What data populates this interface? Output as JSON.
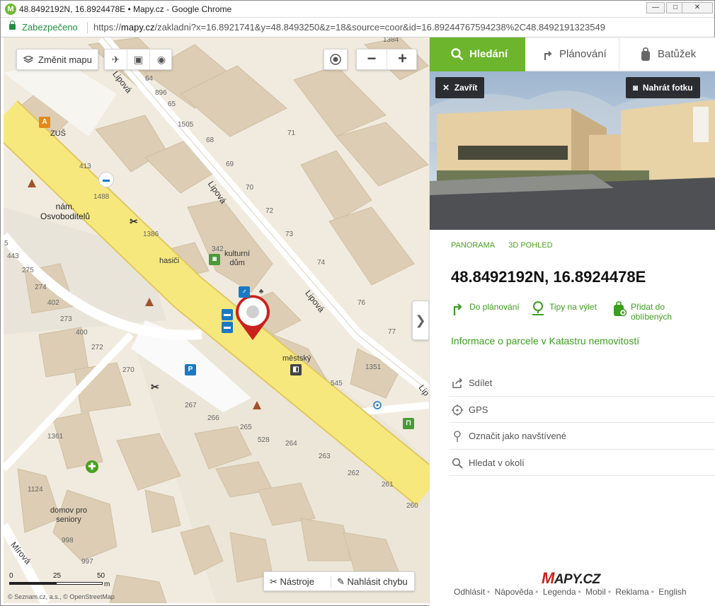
{
  "window": {
    "title": "48.8492192N, 16.8924478E • Mapy.cz - Google Chrome",
    "app_icon": "M",
    "btn_min": "—",
    "btn_max": "□",
    "btn_close": "✕"
  },
  "address_bar": {
    "secure_label": "Zabezpečeno",
    "url_prefix": "https://",
    "url_domain": "mapy.cz",
    "url_rest": "/zakladni?x=16.8921741&y=48.8493250&z=18&source=coor&id=16.89244767594238%2C48.8492191323549"
  },
  "map": {
    "change_map_label": "Změnit mapu",
    "layer_icons": [
      "airplane-icon",
      "cube-icon",
      "eye-icon"
    ],
    "zoom_out": "−",
    "zoom_in": "+",
    "collapse_arrow": "❯",
    "tools_label": "Nástroje",
    "report_label": "Nahlásit chybu",
    "scale_labels": [
      "0",
      "25",
      "50",
      "m"
    ],
    "copyright": "© Seznam.cz, a.s., © OpenStreetMap",
    "streets": [
      "Lipová",
      "Lipová",
      "Lipová",
      "Lip",
      "Mírová"
    ],
    "places": {
      "square": "nám.\nOsvoboditelů",
      "zus": "ZUŠ",
      "hasici": "hasiči",
      "culture": "kulturní\ndům",
      "city": "městský\nd",
      "seniors": "domov pro\nseniory"
    },
    "house_numbers": [
      "1384",
      "64",
      "896",
      "65",
      "1505",
      "71",
      "68",
      "69",
      "70",
      "413",
      "1488",
      "72",
      "1386",
      "73",
      "342",
      "74",
      "443",
      "275",
      "274",
      "402",
      "76",
      "273",
      "400",
      "77",
      "272",
      "545",
      "1351",
      "270",
      "267",
      "266",
      "265",
      "528",
      "264",
      "1361",
      "263",
      "262",
      "261",
      "1124",
      "260",
      "998",
      "997",
      "5"
    ]
  },
  "panel": {
    "tabs": [
      {
        "label": "Hledání",
        "active": true
      },
      {
        "label": "Plánování",
        "active": false
      },
      {
        "label": "Batůžek",
        "active": false
      }
    ],
    "close_label": "Zavřít",
    "upload_label": "Nahrát fotku",
    "view_links": [
      "PANORAMA",
      "3D POHLED"
    ],
    "coordinates": "48.8492192N, 16.8924478E",
    "actions": [
      {
        "label": "Do plánování"
      },
      {
        "label": "Tipy na výlet"
      },
      {
        "label": "Přidat do\noblíbených"
      }
    ],
    "cadastre_link": "Informace o parcele v Katastru nemovitostí",
    "menu": [
      {
        "label": "Sdílet",
        "icon": "share-icon"
      },
      {
        "label": "GPS",
        "icon": "gps-icon"
      },
      {
        "label": "Označit jako navštívené",
        "icon": "visited-pin-icon"
      },
      {
        "label": "Hledat v okolí",
        "icon": "search-icon"
      }
    ],
    "logo_m": "M",
    "logo_rest": "APY.CZ",
    "footer": [
      "Odhlásit",
      "Nápověda",
      "Legenda",
      "Mobil",
      "Reklama",
      "English"
    ]
  },
  "colors": {
    "brand_green": "#6cb52d",
    "link_green": "#3c9e1e",
    "main_road": "#f7e87e",
    "marker_red": "#c9211e"
  }
}
